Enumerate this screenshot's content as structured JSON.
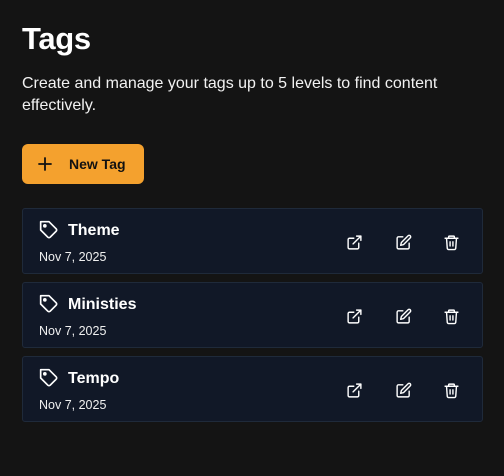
{
  "header": {
    "title": "Tags",
    "subtitle": "Create and manage your tags up to 5 levels to find content effectively."
  },
  "actions": {
    "new_tag_label": "New Tag",
    "new_tag_icon": "plus-icon"
  },
  "colors": {
    "background": "#141414",
    "card": "#111827",
    "accent": "#f4a12e"
  },
  "tags": [
    {
      "name": "Theme",
      "date": "Nov 7, 2025"
    },
    {
      "name": "Ministies",
      "date": "Nov 7, 2025"
    },
    {
      "name": "Tempo",
      "date": "Nov 7, 2025"
    }
  ],
  "row_icons": [
    "tag-icon",
    "external-link-icon",
    "edit-icon",
    "trash-icon"
  ]
}
